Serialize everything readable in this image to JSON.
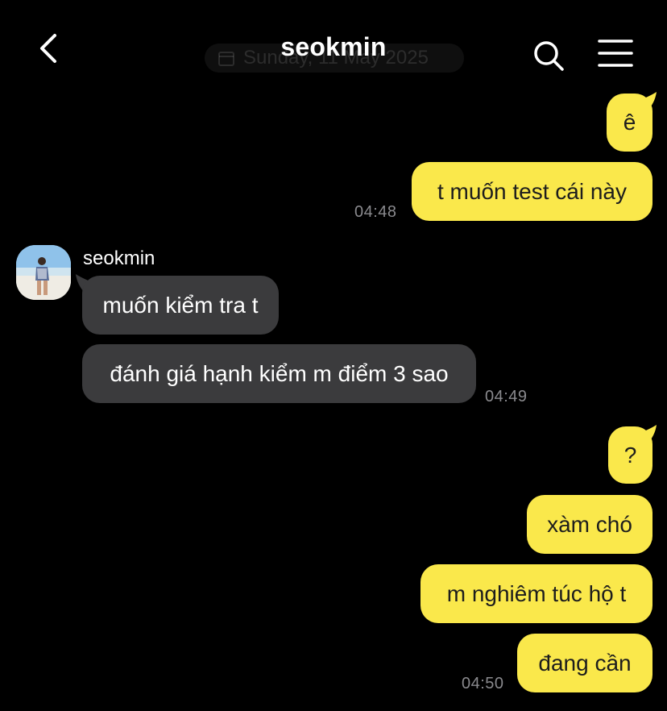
{
  "header": {
    "title": "seokmin",
    "date_pill": "Sunday, 11 May 2025",
    "back_icon": "chevron-left-icon",
    "search_icon": "search-icon",
    "menu_icon": "hamburger-menu-icon"
  },
  "contact": {
    "name": "seokmin"
  },
  "messages": {
    "m1": "ê",
    "m2": "t muốn test cái này",
    "t1": "04:48",
    "m3": "muốn kiểm tra t",
    "m4": "đánh giá hạnh kiểm m điểm 3 sao",
    "t2": "04:49",
    "m5": "?",
    "m6": "xàm chó",
    "m7": "m nghiêm túc hộ t",
    "m8": "đang cần",
    "t3": "04:50"
  },
  "colors": {
    "outgoing_bubble": "#fae84b",
    "incoming_bubble": "#3b3b3d",
    "background": "#000000",
    "timestamp": "#8a8a8e"
  }
}
